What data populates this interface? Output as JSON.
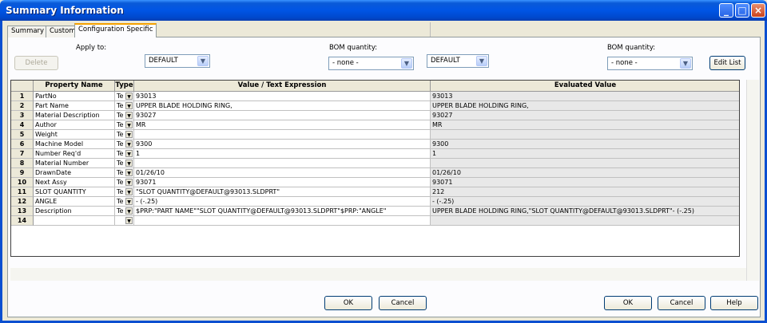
{
  "window": {
    "title": "Summary Information"
  },
  "tabs": [
    {
      "label": "Summary"
    },
    {
      "label": "Custom"
    },
    {
      "label": "Configuration Specific"
    }
  ],
  "controls": {
    "apply_to_label": "Apply to:",
    "delete_label": "Delete",
    "config_left": "DEFAULT",
    "bom_label_left": "BOM quantity:",
    "bom_left": "- none -",
    "config_right": "DEFAULT",
    "bom_label_right": "BOM quantity:",
    "bom_right": "- none -",
    "edit_list_label": "Edit List"
  },
  "table": {
    "headers": [
      "Property Name",
      "Type",
      "Value / Text Expression",
      "Evaluated Value"
    ],
    "rows": [
      {
        "num": "1",
        "name": "PartNo",
        "type": "Te",
        "value": "93013",
        "evaluated": "93013"
      },
      {
        "num": "2",
        "name": "Part Name",
        "type": "Te",
        "value": "UPPER BLADE HOLDING RING,",
        "evaluated": "UPPER BLADE HOLDING RING,"
      },
      {
        "num": "3",
        "name": "Material Description",
        "type": "Te",
        "value": "93027",
        "evaluated": "93027"
      },
      {
        "num": "4",
        "name": "Author",
        "type": "Te",
        "value": "MR",
        "evaluated": "MR"
      },
      {
        "num": "5",
        "name": "Weight",
        "type": "Te",
        "value": "",
        "evaluated": ""
      },
      {
        "num": "6",
        "name": "Machine Model",
        "type": "Te",
        "value": "9300",
        "evaluated": "9300"
      },
      {
        "num": "7",
        "name": "Number Req'd",
        "type": "Te",
        "value": "1",
        "evaluated": "1"
      },
      {
        "num": "8",
        "name": "Material Number",
        "type": "Te",
        "value": "",
        "evaluated": ""
      },
      {
        "num": "9",
        "name": "DrawnDate",
        "type": "Te",
        "value": "01/26/10",
        "evaluated": "01/26/10"
      },
      {
        "num": "10",
        "name": "Next Assy",
        "type": "Te",
        "value": "93071",
        "evaluated": "93071"
      },
      {
        "num": "11",
        "name": "SLOT QUANTITY",
        "type": "Te",
        "value": "\"SLOT QUANTITY@DEFAULT@93013.SLDPRT\"",
        "evaluated": "212"
      },
      {
        "num": "12",
        "name": "ANGLE",
        "type": "Te",
        "value": "- (-.25)",
        "evaluated": "- (-.25)"
      },
      {
        "num": "13",
        "name": "Description",
        "type": "Te",
        "value": "$PRP:\"PART NAME\"\"SLOT QUANTITY@DEFAULT@93013.SLDPRT\"$PRP:\"ANGLE\"",
        "evaluated": "UPPER BLADE HOLDING RING,\"SLOT QUANTITY@DEFAULT@93013.SLDPRT\"- (-.25)"
      },
      {
        "num": "14",
        "name": "",
        "type": "",
        "value": "",
        "evaluated": ""
      }
    ]
  },
  "buttons": {
    "ok_left": "OK",
    "cancel_left": "Cancel",
    "ok_right": "OK",
    "cancel_right": "Cancel",
    "help": "Help"
  },
  "colors": {
    "titlebar": "#0055e5",
    "dialog": "#ece9d8",
    "active_tab_accent": "#f4a100"
  }
}
